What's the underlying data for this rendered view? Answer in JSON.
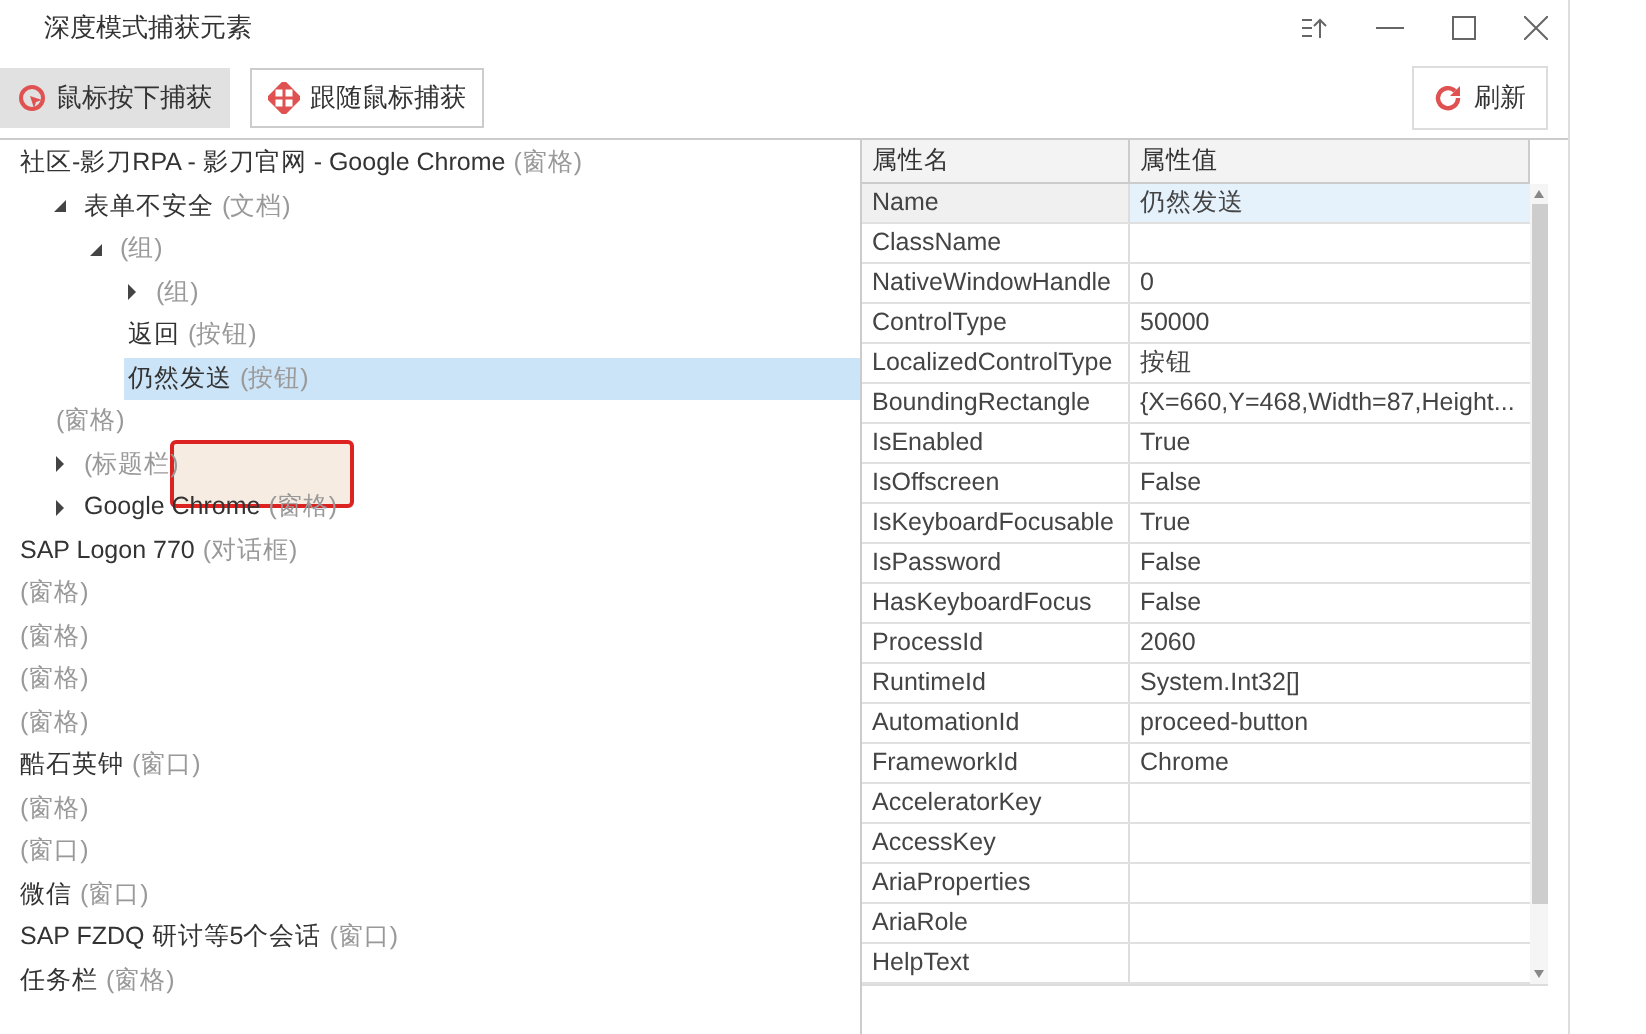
{
  "window": {
    "title": "深度模式捕获元素"
  },
  "toolbar": {
    "capture_modes": [
      {
        "label": "鼠标按下捕获",
        "selected": true
      },
      {
        "label": "跟随鼠标捕获",
        "selected": false
      }
    ],
    "refresh": "刷新"
  },
  "tree": [
    {
      "label": "社区-影刀RPA - 影刀官网 - Google Chrome",
      "type": "(窗格)",
      "selected": false,
      "children": [
        {
          "label": "表单不安全",
          "type": "(文档)",
          "expanded": true,
          "selected": false,
          "children": [
            {
              "type": "(组)",
              "expanded": true,
              "selected": false,
              "children": [
                {
                  "type": "(组)",
                  "expanded": false,
                  "selected": false
                },
                {
                  "label": "返回",
                  "type": "(按钮)",
                  "selected": false
                },
                {
                  "label": "仍然发送",
                  "type": "(按钮)",
                  "selected": true
                }
              ]
            }
          ]
        },
        {
          "type": "(窗格)",
          "selected": false
        },
        {
          "type": "(标题栏)",
          "expanded": false,
          "selected": false
        },
        {
          "label": "Google Chrome",
          "type": "(窗格)",
          "expanded": false,
          "selected": false
        }
      ]
    },
    {
      "label": "SAP Logon 770",
      "type": "(对话框)",
      "selected": false
    },
    {
      "type": "(窗格)",
      "selected": false
    },
    {
      "type": "(窗格)",
      "selected": false
    },
    {
      "type": "(窗格)",
      "selected": false
    },
    {
      "type": "(窗格)",
      "selected": false
    },
    {
      "label": "酷石英钟",
      "type": "(窗口)",
      "selected": false
    },
    {
      "type": "(窗格)",
      "selected": false
    },
    {
      "type": "(窗口)",
      "selected": false
    },
    {
      "label": "微信",
      "type": "(窗口)",
      "selected": false
    },
    {
      "label": "SAP FZDQ 研讨等5个会话",
      "type": "(窗口)",
      "selected": false
    },
    {
      "label": "任务栏",
      "type": "(窗格)",
      "selected": false
    }
  ],
  "properties": {
    "columns": [
      "属性名",
      "属性值"
    ],
    "rows": [
      {
        "name": "Name",
        "value": "仍然发送",
        "selected": true
      },
      {
        "name": "ClassName",
        "selected": false
      },
      {
        "name": "NativeWindowHandle",
        "value": "0",
        "selected": false
      },
      {
        "name": "ControlType",
        "value": "50000",
        "selected": false
      },
      {
        "name": "LocalizedControlType",
        "value": "按钮",
        "selected": false
      },
      {
        "name": "BoundingRectangle",
        "value": "{X=660,Y=468,Width=87,Height...",
        "selected": false
      },
      {
        "name": "IsEnabled",
        "value": "True",
        "selected": false
      },
      {
        "name": "IsOffscreen",
        "value": "False",
        "selected": false
      },
      {
        "name": "IsKeyboardFocusable",
        "value": "True",
        "selected": false
      },
      {
        "name": "IsPassword",
        "value": "False",
        "selected": false
      },
      {
        "name": "HasKeyboardFocus",
        "value": "False",
        "selected": false
      },
      {
        "name": "ProcessId",
        "value": "2060",
        "selected": false
      },
      {
        "name": "RuntimeId",
        "value": "System.Int32[]",
        "selected": false
      },
      {
        "name": "AutomationId",
        "value": "proceed-button",
        "selected": false
      },
      {
        "name": "FrameworkId",
        "value": "Chrome",
        "selected": false
      },
      {
        "name": "AcceleratorKey",
        "selected": false
      },
      {
        "name": "AccessKey",
        "selected": false
      },
      {
        "name": "AriaProperties",
        "selected": false
      },
      {
        "name": "AriaRole",
        "selected": false
      },
      {
        "name": "HelpText",
        "selected": false
      }
    ]
  }
}
